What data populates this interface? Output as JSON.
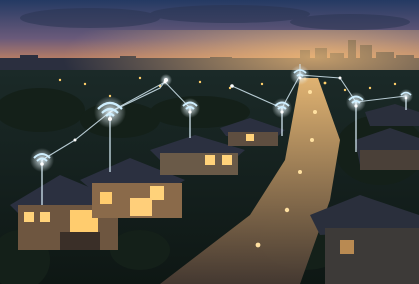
{
  "scene": {
    "subject": "smart-neighborhood-at-dusk",
    "palette": {
      "sky_top": "#243a63",
      "sky_mid": "#6a5a7a",
      "sky_horizon": "#e0905a",
      "city_glow": "#f4b26a",
      "tree_dark": "#0f1a16",
      "tree_mid": "#1c2b22",
      "roof": "#2b3040",
      "wall_lit": "#d9a869",
      "window_glow": "#ffd27a",
      "road": "#5a4b3f",
      "street_light": "#ffcf6a",
      "wifi_glow": "#bfe8ff",
      "connection_line": "#dff4ff"
    },
    "icons": [
      "wifi-icon",
      "wifi-icon",
      "wifi-icon",
      "wifi-icon",
      "wifi-icon",
      "wifi-icon",
      "wifi-icon",
      "wifi-icon"
    ]
  }
}
